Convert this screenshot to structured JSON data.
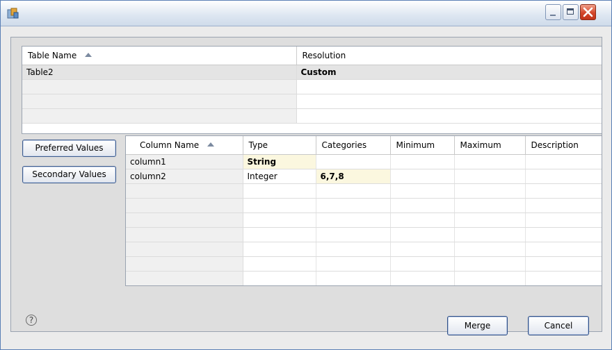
{
  "window": {
    "title": ""
  },
  "tables_grid": {
    "columns": [
      "Table Name",
      "Resolution"
    ],
    "rows": [
      {
        "table_name": "Table2",
        "resolution": "Custom"
      }
    ]
  },
  "side_buttons": {
    "preferred": "Preferred Values",
    "secondary": "Secondary Values"
  },
  "columns_grid": {
    "columns": [
      "Column Name",
      "Type",
      "Categories",
      "Minimum",
      "Maximum",
      "Description"
    ],
    "rows": [
      {
        "name": "column1",
        "type": "String",
        "categories": "",
        "minimum": "",
        "maximum": "",
        "description": ""
      },
      {
        "name": "column2",
        "type": "Integer",
        "categories": "6,7,8",
        "minimum": "",
        "maximum": "",
        "description": ""
      }
    ]
  },
  "footer": {
    "help": "?",
    "merge": "Merge",
    "cancel": "Cancel"
  }
}
